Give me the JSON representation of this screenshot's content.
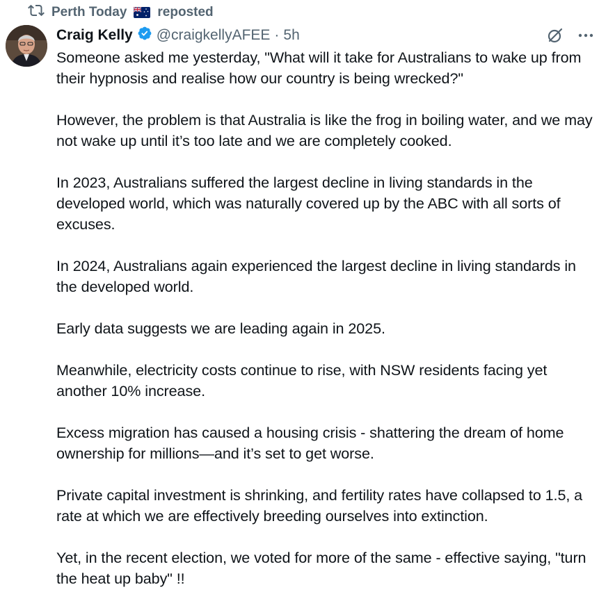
{
  "repost": {
    "account": "Perth Today",
    "label": "reposted"
  },
  "tweet": {
    "author_name": "Craig Kelly",
    "handle": "@craigkellyAFEE",
    "separator": "·",
    "time": "5h",
    "paragraphs": [
      "Someone asked me yesterday, \"What will it take for Australians to wake up from their hypnosis and realise how our country is being wrecked?\"",
      "However, the problem is that Australia is like the frog in boiling water, and we may not wake up until it’s too late and we are completely cooked.",
      "In 2023, Australians suffered the largest decline in living standards in the developed world, which was naturally covered up by the ABC with all sorts of excuses.",
      "In 2024, Australians again experienced the largest decline in living standards in the developed world.",
      "Early data suggests we are leading again in 2025.",
      "Meanwhile, electricity costs continue to rise, with NSW residents facing yet another 10% increase.",
      "Excess migration has caused a housing crisis - shattering the dream of home ownership for millions—and it’s set to get worse.",
      "Private capital investment is shrinking, and fertility rates have collapsed to 1.5, a rate at which we are effectively breeding ourselves into extinction.",
      "Yet, in the recent election, we voted for more of the same - effective saying, \"turn the heat up baby\" !!"
    ]
  },
  "icons": {
    "repost": "repost-icon",
    "flag": "australia-flag-icon",
    "verified": "verified-badge-icon",
    "grok": "grok-icon",
    "more": "more-icon"
  },
  "colors": {
    "text": "#0f1419",
    "secondary": "#536471",
    "verified": "#1d9bf0",
    "background": "#ffffff"
  }
}
